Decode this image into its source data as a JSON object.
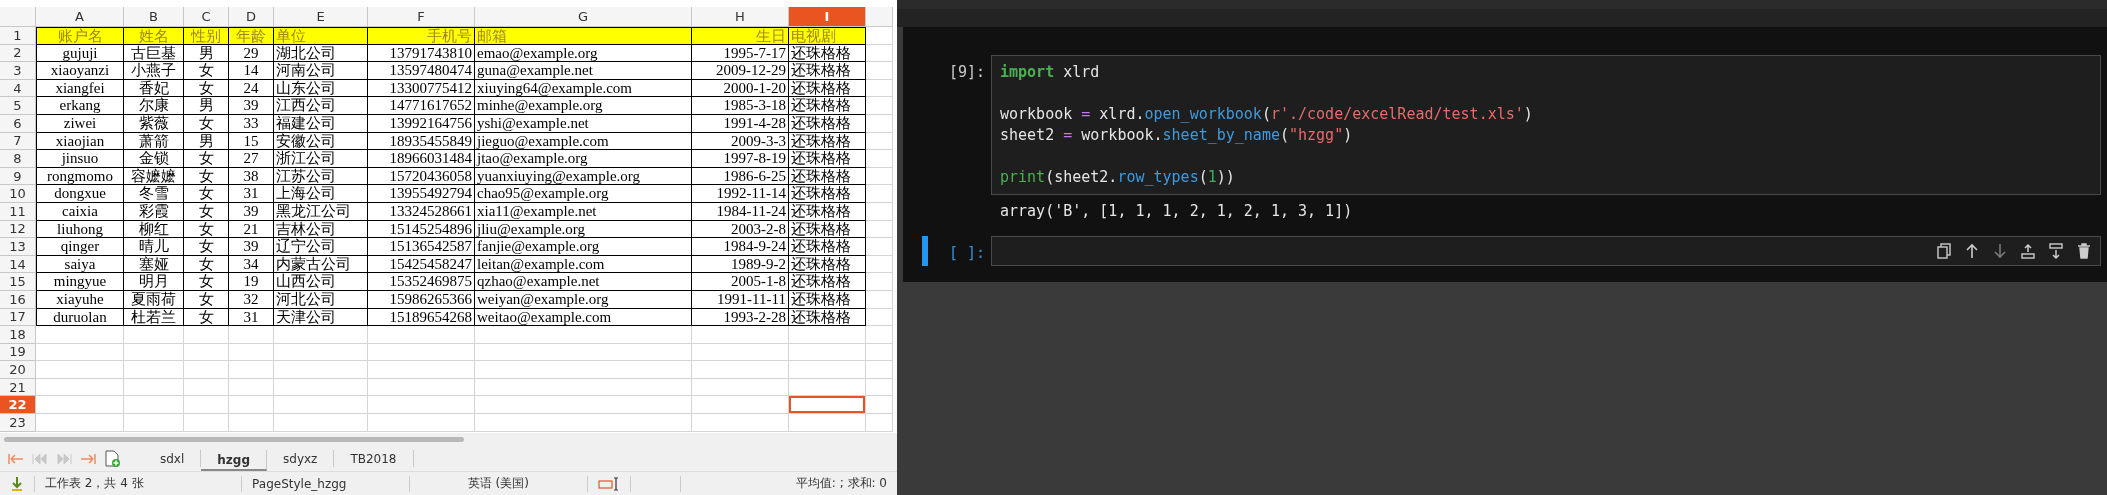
{
  "spreadsheet": {
    "columns": [
      {
        "letter": "A",
        "selected": false
      },
      {
        "letter": "B",
        "selected": false
      },
      {
        "letter": "C",
        "selected": false
      },
      {
        "letter": "D",
        "selected": false
      },
      {
        "letter": "E",
        "selected": false
      },
      {
        "letter": "F",
        "selected": false
      },
      {
        "letter": "G",
        "selected": false
      },
      {
        "letter": "H",
        "selected": false
      },
      {
        "letter": "I",
        "selected": true
      }
    ],
    "rows": [
      {
        "number": "1",
        "selected": false,
        "cells": [
          "账户名",
          "姓名",
          "性别",
          "年龄",
          "单位",
          "手机号",
          "邮箱",
          "生日",
          "电视剧"
        ]
      },
      {
        "number": "2",
        "selected": false,
        "cells": [
          "gujuji",
          "古巨基",
          "男",
          "29",
          "湖北公司",
          "13791743810",
          "emao@example.org",
          "1995-7-17",
          "还珠格格"
        ]
      },
      {
        "number": "3",
        "selected": false,
        "cells": [
          "xiaoyanzi",
          "小燕子",
          "女",
          "14",
          "河南公司",
          "13597480474",
          "guna@example.net",
          "2009-12-29",
          "还珠格格"
        ]
      },
      {
        "number": "4",
        "selected": false,
        "cells": [
          "xiangfei",
          "香妃",
          "女",
          "24",
          "山东公司",
          "13300775412",
          "xiuying64@example.com",
          "2000-1-20",
          "还珠格格"
        ]
      },
      {
        "number": "5",
        "selected": false,
        "cells": [
          "erkang",
          "尔康",
          "男",
          "39",
          "江西公司",
          "14771617652",
          "minhe@example.org",
          "1985-3-18",
          "还珠格格"
        ]
      },
      {
        "number": "6",
        "selected": false,
        "cells": [
          "ziwei",
          "紫薇",
          "女",
          "33",
          "福建公司",
          "13992164756",
          "yshi@example.net",
          "1991-4-28",
          "还珠格格"
        ]
      },
      {
        "number": "7",
        "selected": false,
        "cells": [
          "xiaojian",
          "萧箭",
          "男",
          "15",
          "安徽公司",
          "18935455849",
          "jieguo@example.com",
          "2009-3-3",
          "还珠格格"
        ]
      },
      {
        "number": "8",
        "selected": false,
        "cells": [
          "jinsuo",
          "金锁",
          "女",
          "27",
          "浙江公司",
          "18966031484",
          "jtao@example.org",
          "1997-8-19",
          "还珠格格"
        ]
      },
      {
        "number": "9",
        "selected": false,
        "cells": [
          "rongmomo",
          "容嬷嬷",
          "女",
          "38",
          "江苏公司",
          "15720436058",
          "yuanxiuying@example.org",
          "1986-6-25",
          "还珠格格"
        ]
      },
      {
        "number": "10",
        "selected": false,
        "cells": [
          "dongxue",
          "冬雪",
          "女",
          "31",
          "上海公司",
          "13955492794",
          "chao95@example.org",
          "1992-11-14",
          "还珠格格"
        ]
      },
      {
        "number": "11",
        "selected": false,
        "cells": [
          "caixia",
          "彩霞",
          "女",
          "39",
          "黑龙江公司",
          "13324528661",
          "xia11@example.net",
          "1984-11-24",
          "还珠格格"
        ]
      },
      {
        "number": "12",
        "selected": false,
        "cells": [
          "liuhong",
          "柳红",
          "女",
          "21",
          "吉林公司",
          "15145254896",
          "jliu@example.org",
          "2003-2-8",
          "还珠格格"
        ]
      },
      {
        "number": "13",
        "selected": false,
        "cells": [
          "qinger",
          "晴儿",
          "女",
          "39",
          "辽宁公司",
          "15136542587",
          "fanjie@example.org",
          "1984-9-24",
          "还珠格格"
        ]
      },
      {
        "number": "14",
        "selected": false,
        "cells": [
          "saiya",
          "塞娅",
          "女",
          "34",
          "内蒙古公司",
          "15425458247",
          "leitan@example.com",
          "1989-9-2",
          "还珠格格"
        ]
      },
      {
        "number": "15",
        "selected": false,
        "cells": [
          "mingyue",
          "明月",
          "女",
          "19",
          "山西公司",
          "15352469875",
          "qzhao@example.net",
          "2005-1-8",
          "还珠格格"
        ]
      },
      {
        "number": "16",
        "selected": false,
        "cells": [
          "xiayuhe",
          "夏雨荷",
          "女",
          "32",
          "河北公司",
          "15986265366",
          "weiyan@example.org",
          "1991-11-11",
          "还珠格格"
        ]
      },
      {
        "number": "17",
        "selected": false,
        "cells": [
          "duruolan",
          "杜若兰",
          "女",
          "31",
          "天津公司",
          "15189654268",
          "weitao@example.com",
          "1993-2-28",
          "还珠格格"
        ]
      },
      {
        "number": "18",
        "selected": false
      },
      {
        "number": "19",
        "selected": false
      },
      {
        "number": "20",
        "selected": false
      },
      {
        "number": "21",
        "selected": false
      },
      {
        "number": "22",
        "selected": true
      },
      {
        "number": "23",
        "selected": false
      }
    ],
    "sheet_tabs": [
      {
        "label": "sdxl",
        "selected": false
      },
      {
        "label": "hzgg",
        "selected": true
      },
      {
        "label": "sdyxz",
        "selected": false
      },
      {
        "label": "TB2018",
        "selected": false
      }
    ],
    "status_bar": {
      "sheet_info": "工作表 2，共 4 张",
      "page_style": "PageStyle_hzgg",
      "language": "英语 (美国)",
      "summary": "平均值: ; 求和: 0"
    }
  },
  "notebook": {
    "cells": [
      {
        "prompt": "[9]:",
        "selected": false,
        "lines": [
          {
            "gap_before": false,
            "tokens": [
              {
                "kind": "keyword",
                "text": "import"
              },
              {
                "kind": "plain",
                "text": " xlrd"
              }
            ]
          },
          {
            "gap_before": true,
            "tokens": [
              {
                "kind": "plain",
                "text": "workbook "
              },
              {
                "kind": "operator",
                "text": "="
              },
              {
                "kind": "plain",
                "text": " xlrd."
              },
              {
                "kind": "function",
                "text": "open_workbook"
              },
              {
                "kind": "plain",
                "text": "("
              },
              {
                "kind": "string",
                "text": "r'./code/excelRead/test.xls'"
              },
              {
                "kind": "plain",
                "text": ")"
              }
            ]
          },
          {
            "gap_before": false,
            "tokens": [
              {
                "kind": "plain",
                "text": "sheet2 "
              },
              {
                "kind": "operator",
                "text": "="
              },
              {
                "kind": "plain",
                "text": " workbook."
              },
              {
                "kind": "function",
                "text": "sheet_by_name"
              },
              {
                "kind": "plain",
                "text": "("
              },
              {
                "kind": "string",
                "text": "\"hzgg\""
              },
              {
                "kind": "plain",
                "text": ")"
              }
            ]
          },
          {
            "gap_before": true,
            "tokens": [
              {
                "kind": "builtin",
                "text": "print"
              },
              {
                "kind": "plain",
                "text": "(sheet2."
              },
              {
                "kind": "function",
                "text": "row_types"
              },
              {
                "kind": "plain",
                "text": "("
              },
              {
                "kind": "number",
                "text": "1"
              },
              {
                "kind": "plain",
                "text": "))"
              }
            ]
          }
        ],
        "output": "array('B', [1, 1, 1, 2, 1, 2, 1, 3, 1])"
      },
      {
        "prompt": "[ ]:",
        "selected": true
      }
    ]
  }
}
